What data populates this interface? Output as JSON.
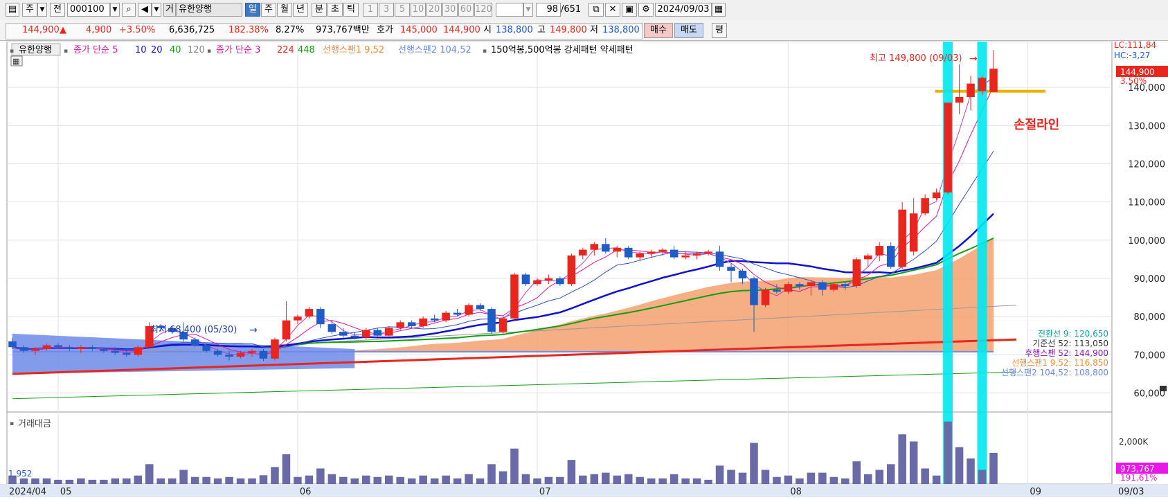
{
  "toolbar": {
    "type_label": "주",
    "jeon_label": "전",
    "code": "000100",
    "search_icon": "search-icon",
    "stock_name_prefix": "거",
    "stock_name": "유한양행",
    "periods": [
      "일",
      "주",
      "월",
      "년",
      "분",
      "초",
      "틱"
    ],
    "selected_period": "일",
    "intervals": [
      "1",
      "3",
      "5",
      "10",
      "20",
      "30",
      "60",
      "120"
    ],
    "count": "98",
    "total": "/651",
    "date": "2024/09/03"
  },
  "quote": {
    "price": "144,900",
    "arrow": "▲",
    "change": "4,900",
    "change_pct": "+3.50%",
    "volume": "6,636,725",
    "volume_ratio": "182.38%",
    "turnover": "8.27%",
    "amount": "973,767백만",
    "hoga_label": "호가",
    "ask": "145,000",
    "bid": "144,900",
    "open_label": "시",
    "open": "138,800",
    "high_label": "고",
    "high": "149,800",
    "low_label": "저",
    "low": "138,800",
    "buy_label": "매수",
    "sell_label": "매도",
    "eval_label": "평"
  },
  "legend": {
    "stock": "유한양행",
    "ma_label": "종가 단순 5",
    "ma10": "10",
    "ma20": "20",
    "ma40": "40",
    "ma120": "120",
    "ma2_label": "종가 단순 3",
    "ma224": "224",
    "ma448": "448",
    "span1": "선행스팬1 9,52",
    "span2": "선행스팬2 104,52",
    "pattern": "150억봉,500억봉 강세패턴  약세패턴"
  },
  "annotations": {
    "high": "최고 149,800 (09/03)",
    "low": "최저 68,400 (05/30)",
    "stop_line": "손절라인",
    "lc": "LC:111,84",
    "hc": "HC:-3,27",
    "last_price": "144,900",
    "last_pct": "3.50%"
  },
  "ichimoku_values": [
    "전환선 9: 120,650",
    "기준선 52: 113,050",
    "후행스팬 52: 144,900",
    "선행스팬1 9,52: 116,850",
    "선행스팬2 104,52: 108,800"
  ],
  "volume_panel": {
    "title": "거래대금",
    "left_value": "1,952",
    "axis_label": "2,000K",
    "last_value": "973,767",
    "last_pct": "191.61%"
  },
  "colors": {
    "up": "#e8261e",
    "down": "#1e5cc8",
    "ma5": "#d818a0",
    "ma20": "#1010d0",
    "ma40": "#10a010",
    "highlight": "#00e8f0",
    "stop_line": "#f0b000",
    "cloud": "#f4a070",
    "cloud_neg": "#6d8ae8"
  },
  "chart_data": {
    "type": "candlestick",
    "x_ticks": [
      "2024/04",
      "05",
      "06",
      "07",
      "08",
      "09",
      "09/03"
    ],
    "y_ticks": [
      60000,
      70000,
      80000,
      90000,
      100000,
      110000,
      120000,
      130000,
      140000
    ],
    "ylim": [
      55000,
      152000
    ],
    "candles": [
      [
        73500,
        74500,
        71500,
        72000
      ],
      [
        72000,
        72500,
        70500,
        71000
      ],
      [
        71000,
        72000,
        70000,
        71500
      ],
      [
        71500,
        73000,
        71000,
        72500
      ],
      [
        72500,
        73000,
        71500,
        72000
      ],
      [
        72000,
        72500,
        71000,
        71500
      ],
      [
        71500,
        72500,
        70500,
        72000
      ],
      [
        72000,
        72500,
        71000,
        71500
      ],
      [
        71500,
        72000,
        70500,
        71000
      ],
      [
        71000,
        72000,
        70000,
        70500
      ],
      [
        70500,
        71500,
        69500,
        70000
      ],
      [
        70000,
        72500,
        69500,
        72000
      ],
      [
        72000,
        78500,
        71500,
        77500
      ],
      [
        77500,
        78000,
        76000,
        77000
      ],
      [
        77000,
        77500,
        75500,
        76000
      ],
      [
        76000,
        78500,
        73500,
        74000
      ],
      [
        74000,
        74500,
        72000,
        72500
      ],
      [
        72500,
        73000,
        70500,
        71000
      ],
      [
        71000,
        71500,
        69500,
        70000
      ],
      [
        70000,
        71000,
        68500,
        69500
      ],
      [
        69500,
        71000,
        69000,
        70500
      ],
      [
        70500,
        71500,
        69500,
        71000
      ],
      [
        71000,
        71500,
        68400,
        69000
      ],
      [
        69000,
        74500,
        68500,
        74000
      ],
      [
        74000,
        84000,
        73500,
        79000
      ],
      [
        79000,
        80500,
        78000,
        80000
      ],
      [
        80000,
        82500,
        79500,
        82000
      ],
      [
        82000,
        82500,
        77000,
        78000
      ],
      [
        78000,
        79000,
        75500,
        76000
      ],
      [
        76000,
        77000,
        74500,
        75000
      ],
      [
        75000,
        76000,
        74000,
        74500
      ],
      [
        74500,
        77000,
        74000,
        76500
      ],
      [
        76500,
        77000,
        74500,
        75000
      ],
      [
        75000,
        77500,
        74500,
        77000
      ],
      [
        77000,
        79000,
        76500,
        78500
      ],
      [
        78500,
        79000,
        77000,
        77500
      ],
      [
        77500,
        80000,
        77000,
        79500
      ],
      [
        79500,
        80500,
        78500,
        79000
      ],
      [
        79000,
        81500,
        78500,
        81000
      ],
      [
        81000,
        82000,
        80000,
        80500
      ],
      [
        80500,
        83500,
        80000,
        83000
      ],
      [
        83000,
        83500,
        81500,
        82000
      ],
      [
        82000,
        82500,
        75500,
        76000
      ],
      [
        76000,
        80000,
        75500,
        79500
      ],
      [
        79500,
        91500,
        79000,
        91000
      ],
      [
        91000,
        91500,
        88000,
        88500
      ],
      [
        88500,
        90000,
        88000,
        89500
      ],
      [
        89500,
        91000,
        88500,
        90000
      ],
      [
        90000,
        90500,
        88000,
        88500
      ],
      [
        88500,
        96500,
        88000,
        96000
      ],
      [
        96000,
        98000,
        95000,
        97500
      ],
      [
        97500,
        99500,
        96000,
        99000
      ],
      [
        99000,
        100500,
        96500,
        97000
      ],
      [
        97000,
        98500,
        95500,
        98000
      ],
      [
        98000,
        98500,
        95000,
        95500
      ],
      [
        95500,
        97000,
        94500,
        96500
      ],
      [
        96500,
        97500,
        95500,
        97000
      ],
      [
        97000,
        98000,
        96000,
        97500
      ],
      [
        97500,
        98500,
        95000,
        95500
      ],
      [
        95500,
        97000,
        95000,
        96000
      ],
      [
        96000,
        97000,
        95000,
        96500
      ],
      [
        96500,
        97500,
        96000,
        97000
      ],
      [
        97000,
        98500,
        92000,
        93000
      ],
      [
        93000,
        94000,
        89000,
        92000
      ],
      [
        92000,
        92500,
        88500,
        90000
      ],
      [
        90000,
        90500,
        76000,
        83000
      ],
      [
        83000,
        87500,
        82500,
        87000
      ],
      [
        87000,
        88500,
        86000,
        86500
      ],
      [
        86500,
        89000,
        86000,
        88500
      ],
      [
        88500,
        89000,
        87000,
        88000
      ],
      [
        88000,
        89500,
        85500,
        89000
      ],
      [
        89000,
        89500,
        85500,
        87000
      ],
      [
        87000,
        89000,
        86500,
        88500
      ],
      [
        88500,
        89000,
        87000,
        88000
      ],
      [
        88000,
        95500,
        87500,
        95000
      ],
      [
        95000,
        96500,
        93000,
        96000
      ],
      [
        96000,
        99500,
        94500,
        98500
      ],
      [
        98500,
        99500,
        92500,
        93000
      ],
      [
        93000,
        110000,
        92500,
        108000
      ],
      [
        97000,
        111000,
        96000,
        107000
      ],
      [
        107000,
        112000,
        106500,
        111000
      ],
      [
        111000,
        113500,
        110500,
        112500
      ],
      [
        112500,
        134000,
        112000,
        136000
      ],
      [
        136000,
        146000,
        133000,
        137500
      ],
      [
        137500,
        143000,
        134000,
        141000
      ],
      [
        139000,
        143000,
        138000,
        142500
      ],
      [
        138800,
        149800,
        138800,
        144900
      ]
    ],
    "stop_line_value": 139000
  }
}
